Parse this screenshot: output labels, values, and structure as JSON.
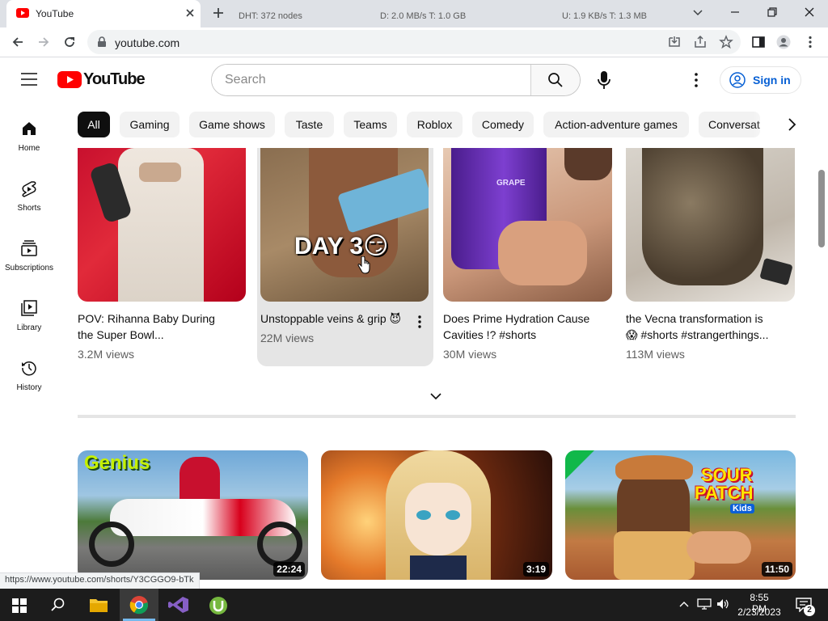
{
  "browser": {
    "tab_title": "YouTube",
    "address": "youtube.com"
  },
  "masthead": {
    "logo_text": "YouTube",
    "search_placeholder": "Search",
    "signin_label": "Sign in"
  },
  "chips": [
    "All",
    "Gaming",
    "Game shows",
    "Taste",
    "Teams",
    "Roblox",
    "Comedy",
    "Action-adventure games",
    "Conversat"
  ],
  "sidebar": {
    "items": [
      {
        "label": "Home",
        "icon": "home-icon"
      },
      {
        "label": "Shorts",
        "icon": "shorts-icon"
      },
      {
        "label": "Subscriptions",
        "icon": "subscriptions-icon"
      },
      {
        "label": "Library",
        "icon": "library-icon"
      },
      {
        "label": "History",
        "icon": "history-icon"
      }
    ]
  },
  "shorts": [
    {
      "title_line1": "POV: Rihanna Baby During",
      "title_line2": "the Super Bowl...",
      "views": "3.2M views"
    },
    {
      "title_line1": "Unstoppable veins & grip 😈",
      "title_line2": "",
      "views": "22M views",
      "thumb_caption": "DAY 3😏"
    },
    {
      "title_line1": "Does Prime Hydration Cause",
      "title_line2": "Cavities !? #shorts",
      "views": "30M views",
      "thumb_caption": "GRAPE"
    },
    {
      "title_line1": "the Vecna transformation is",
      "title_line2": "😱 #shorts #strangerthings...",
      "views": "113M views"
    }
  ],
  "videos": [
    {
      "duration": "22:24",
      "thumb_caption": "Genius"
    },
    {
      "duration": "3:19"
    },
    {
      "duration": "11:50",
      "thumb_caption_1": "SOUR",
      "thumb_caption_2": "PATCH",
      "thumb_caption_3": "Kids"
    }
  ],
  "status_url": "https://www.youtube.com/shorts/Y3CGGO9-bTk",
  "taskbar": {
    "torrent_status": {
      "dht": "DHT: 372 nodes",
      "down": "D: 2.0 MB/s T: 1.0 GB",
      "up": "U: 1.9 KB/s T: 1.3 MB"
    },
    "time": "8:55 PM",
    "date": "2/23/2023",
    "notifications": "2"
  },
  "colors": {
    "brand_red": "#ff0000",
    "link_blue": "#065fd4"
  }
}
